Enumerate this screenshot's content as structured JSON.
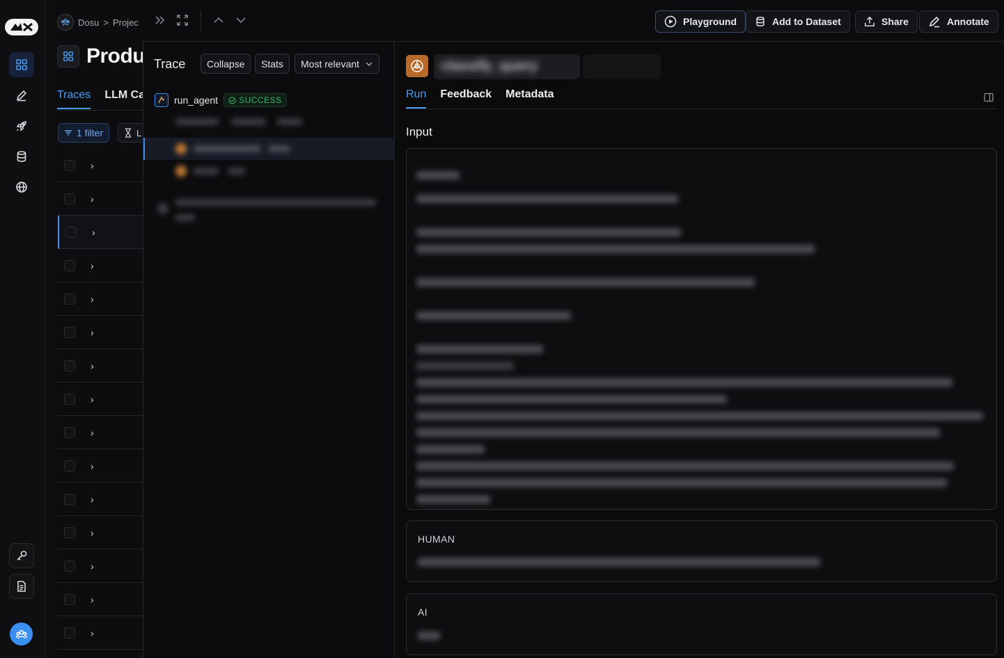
{
  "breadcrumb": {
    "org": "Dosu",
    "separator": ">",
    "project": "Projec"
  },
  "project": {
    "title": "Produ"
  },
  "list_tabs": {
    "traces": "Traces",
    "llm_calls": "LLM Ca"
  },
  "filter": {
    "label": "1 filter",
    "second_label": "L"
  },
  "list_rows": {
    "chevron": "›"
  },
  "trace": {
    "title": "Trace",
    "collapse": "Collapse",
    "stats": "Stats",
    "sort": "Most relevant",
    "root_name": "run_agent",
    "root_status": "SUCCESS"
  },
  "toolbar": {
    "playground": "Playground",
    "add_to_dataset": "Add to Dataset",
    "share": "Share",
    "annotate": "Annotate"
  },
  "run": {
    "name": "classify_query",
    "tabs": {
      "run": "Run",
      "feedback": "Feedback",
      "metadata": "Metadata"
    },
    "input_title": "Input",
    "human_label": "HUMAN",
    "ai_label": "AI"
  },
  "colors": {
    "accent": "#3b8ff0",
    "success": "#38b36a",
    "run_icon": "#b86a2a"
  }
}
